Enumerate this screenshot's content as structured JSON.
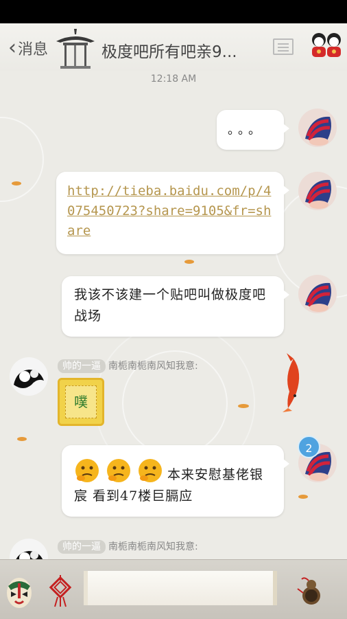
{
  "header": {
    "back_label": "消息",
    "title": "极度吧所有吧亲9...",
    "icons": [
      "pagoda-icon",
      "menu-icon",
      "dolls-icon"
    ]
  },
  "timestamp": "12:18 AM",
  "messages": [
    {
      "side": "right",
      "type": "text",
      "text": "。。。"
    },
    {
      "side": "right",
      "type": "link",
      "text": "http://tieba.baidu.com/p/4075450723?share=9105&fr=share"
    },
    {
      "side": "right",
      "type": "text",
      "text": "我该不该建一个贴吧叫做极度吧战场"
    },
    {
      "side": "left",
      "type": "sticker",
      "badge": "帅的一逼",
      "sender": "南栀南栀南风知我意:",
      "sticker_text": "噗"
    },
    {
      "side": "right",
      "type": "text",
      "emoji": "thinking-emoji",
      "text": "本来安慰基佬银宸 看到47楼巨膈应"
    },
    {
      "side": "left",
      "type": "partial",
      "badge": "帅的一逼",
      "sender": "南栀南栀南风知我意:"
    }
  ],
  "unread_count": "2",
  "bottom": {
    "icons": [
      "opera-mask-icon",
      "chinese-knot-icon",
      "gourd-icon"
    ],
    "input_placeholder": ""
  },
  "colors": {
    "link": "#b5964e",
    "unread": "#4fa3e0",
    "background": "#ecebe6"
  }
}
